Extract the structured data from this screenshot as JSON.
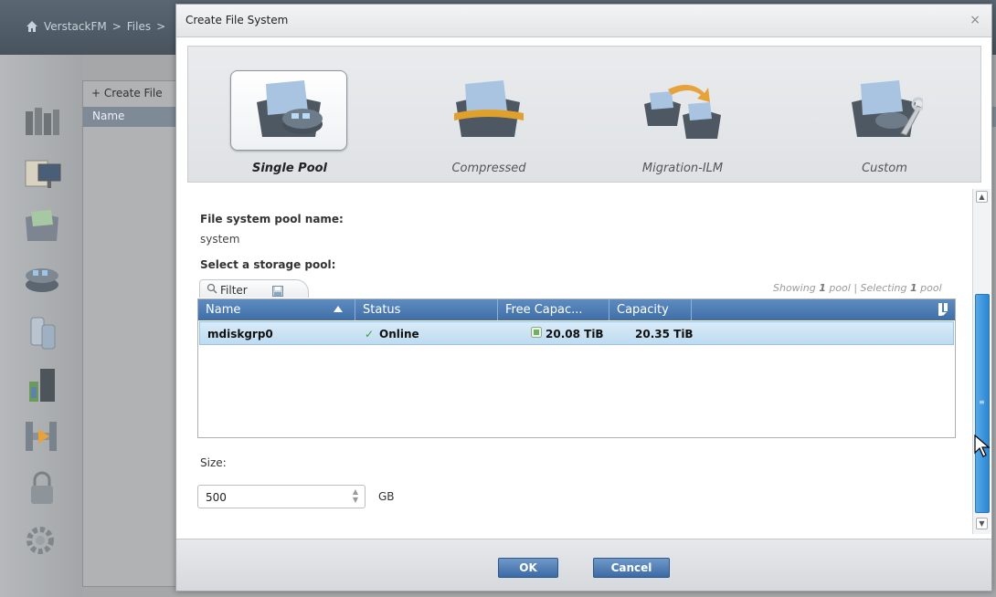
{
  "background": {
    "breadcrumb": [
      "VerstackFM",
      ">",
      "Files",
      ">"
    ],
    "create_label": "+ Create File",
    "name_header": "Name"
  },
  "dialog": {
    "title": "Create File System",
    "close_glyph": "×",
    "types": [
      {
        "label": "Single Pool",
        "icon": "single-pool-icon",
        "selected": true
      },
      {
        "label": "Compressed",
        "icon": "compressed-icon",
        "selected": false
      },
      {
        "label": "Migration-ILM",
        "icon": "migration-ilm-icon",
        "selected": false
      },
      {
        "label": "Custom",
        "icon": "custom-icon",
        "selected": false
      }
    ],
    "pool_name_label": "File system pool name:",
    "pool_name_value": "system",
    "storage_pool_label": "Select a storage pool:",
    "filter_label": "Filter",
    "showing": {
      "prefix": "Showing ",
      "count": "1",
      "mid": " pool | Selecting ",
      "selected": "1",
      "suffix": " pool"
    },
    "table": {
      "columns": [
        "Name",
        "Status",
        "Free Capac...",
        "Capacity"
      ],
      "rows": [
        {
          "name": "mdiskgrp0",
          "status": "Online",
          "free_capacity": "20.08 TiB",
          "capacity": "20.35 TiB"
        }
      ]
    },
    "size_label": "Size:",
    "size_value": "500",
    "size_unit": "GB",
    "ok_label": "OK",
    "cancel_label": "Cancel"
  },
  "colors": {
    "header_blue": "#4a79b2",
    "selected_row": "#c9e2f4",
    "scroll_thumb": "#3a95dc",
    "online_check": "#3aa03a"
  }
}
